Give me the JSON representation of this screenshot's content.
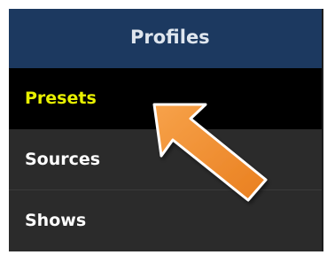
{
  "sidebar": {
    "title": "Profiles",
    "items": [
      {
        "label": "Presets",
        "selected": true
      },
      {
        "label": "Sources",
        "selected": false
      },
      {
        "label": "Shows",
        "selected": false
      }
    ]
  },
  "colors": {
    "header_bg": "#1c3960",
    "header_text": "#dfe6ee",
    "selected_bg": "#000000",
    "selected_text": "#e8f000",
    "item_bg": "#2b2b2b",
    "item_text": "#ffffff",
    "callout_arrow": "#f08c2c"
  },
  "annotation": {
    "icon": "arrow-pointer-icon",
    "points_to": "Presets"
  }
}
